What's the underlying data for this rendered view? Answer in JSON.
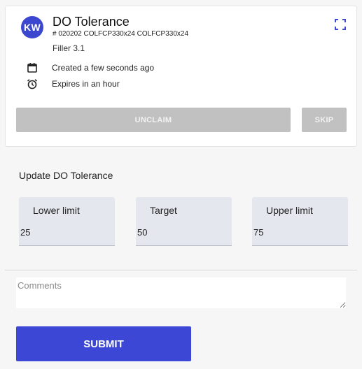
{
  "task": {
    "avatar_initials": "KW",
    "title": "DO Tolerance",
    "id_line": "# 020202 COLFCP330x24 COLFCP330x24",
    "subtitle": "Filler 3.1",
    "created": "Created a few seconds ago",
    "expires": "Expires in an hour",
    "unclaim_label": "UNCLAIM",
    "skip_label": "SKIP"
  },
  "form": {
    "section_title": "Update DO Tolerance",
    "lower": {
      "label": "Lower limit",
      "value": "25"
    },
    "target": {
      "label": "Target",
      "value": "50"
    },
    "upper": {
      "label": "Upper limit",
      "value": "75"
    },
    "comments_placeholder": "Comments",
    "submit_label": "SUBMIT"
  },
  "colors": {
    "accent": "#3c47d6",
    "disabled_button": "#c1c1c1",
    "field_background": "#e5e7ee"
  },
  "icons": {
    "expand": "expand-icon",
    "calendar": "calendar-icon",
    "alarm": "alarm-clock-icon"
  }
}
